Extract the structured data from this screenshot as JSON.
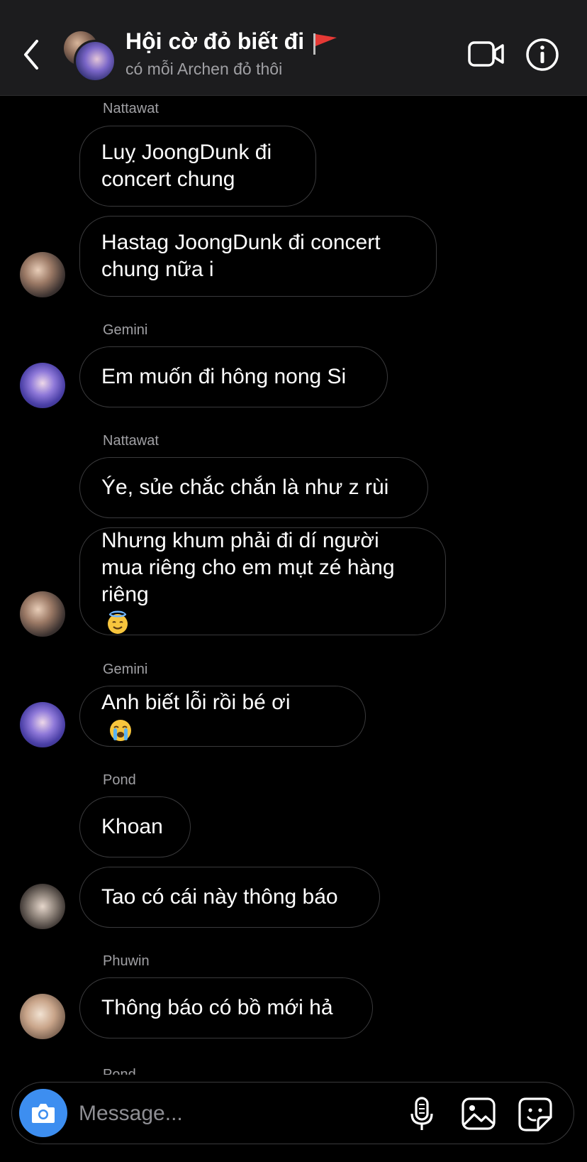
{
  "header": {
    "title": "Hội cờ đỏ biết đi",
    "subtitle": "có mỗi Archen đỏ thôi"
  },
  "colors": {
    "accent": "#3d8ef0",
    "flag": "#e53935",
    "background": "#000000",
    "header_bg": "#1c1c1e",
    "bubble_border": "#3a3a3c"
  },
  "messages": [
    {
      "sender": "Nattawat",
      "lines": [
        "Luỵ JoongDunk đi",
        "concert chung"
      ]
    },
    {
      "lines": [
        "Hastag JoongDunk đi concert",
        "chung nữa i"
      ]
    },
    {
      "sender": "Gemini",
      "lines": [
        "Em muốn đi hông nong Si"
      ]
    },
    {
      "sender": "Nattawat",
      "lines": [
        "Ýe, sủe chắc chắn là như z rùi"
      ]
    },
    {
      "lines": [
        "Nhưng khum phải đi dí người",
        "mua riêng cho em mụt zé hàng",
        "riêng"
      ]
    },
    {
      "sender": "Gemini",
      "lines": [
        "Anh biết lỗi rồi bé ơi"
      ]
    },
    {
      "sender": "Pond",
      "lines": [
        "Khoan"
      ]
    },
    {
      "lines": [
        "Tao có cái này thông báo"
      ]
    },
    {
      "sender": "Phuwin",
      "lines": [
        "Thông báo có bồ mới hả"
      ]
    }
  ],
  "cut_off_sender": "Pond",
  "composer": {
    "placeholder": "Message..."
  },
  "icons": {
    "back": "chevron-left-icon",
    "video": "video-camera-icon",
    "info": "info-icon",
    "camera": "camera-icon",
    "mic": "microphone-icon",
    "gallery": "image-icon",
    "sticker": "sticker-icon",
    "flag": "red-flag-icon",
    "angel_emoji": "smiling-face-with-halo-emoji",
    "cry_emoji": "loudly-crying-face-emoji"
  }
}
